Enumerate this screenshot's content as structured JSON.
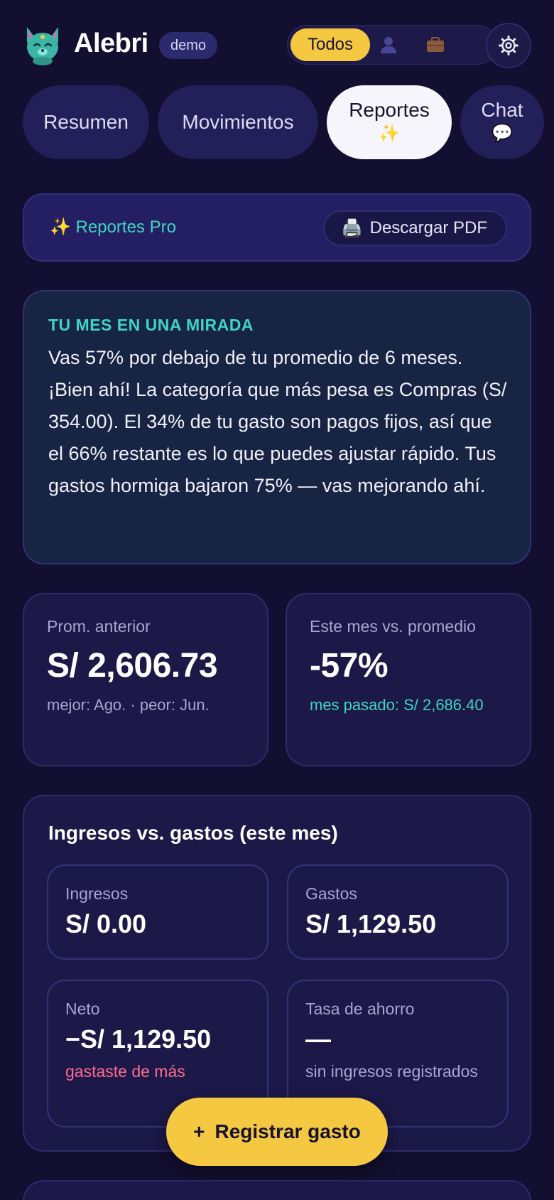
{
  "header": {
    "app_name": "Alebri",
    "mode_badge": "demo",
    "filter": {
      "todos_label": "Todos",
      "personal_icon": "person-icon",
      "business_icon": "briefcase-icon"
    },
    "settings_icon": "gear-icon"
  },
  "tabs": [
    {
      "label": "Resumen"
    },
    {
      "label": "Movimientos"
    },
    {
      "label": "Reportes",
      "emoji": "✨"
    },
    {
      "label": "Chat",
      "emoji": "💬"
    }
  ],
  "pro_bar": {
    "label": "✨ Reportes Pro",
    "download_icon": "🖨️",
    "download_label": "Descargar PDF"
  },
  "insight": {
    "title": "TU MES EN UNA MIRADA",
    "body": "Vas 57% por debajo de tu promedio de 6 meses. ¡Bien ahí! La categoría que más pesa es Compras (S/ 354.00). El 34% de tu gasto son pagos fijos, así que el 66% restante es lo que puedes ajustar rápido. Tus gastos hormiga bajaron 75% — vas mejorando ahí."
  },
  "stats": {
    "avg": {
      "label": "Prom. anterior",
      "value": "S/ 2,606.73",
      "sub": "mejor: Ago. · peor: Jun."
    },
    "vs": {
      "label": "Este mes vs. promedio",
      "value": "-57%",
      "sub": "mes pasado: S/ 2,686.40"
    }
  },
  "income_vs_expenses": {
    "title": "Ingresos vs. gastos (este mes)",
    "income": {
      "label": "Ingresos",
      "value": "S/ 0.00"
    },
    "expenses": {
      "label": "Gastos",
      "value": "S/ 1,129.50"
    },
    "net": {
      "label": "Neto",
      "value": "−S/ 1,129.50",
      "sub": "gastaste de más"
    },
    "savings": {
      "label": "Tasa de ahorro",
      "value": "—",
      "sub": "sin ingresos registrados"
    }
  },
  "fab": {
    "plus": "+",
    "label": "Registrar gasto"
  },
  "colors": {
    "background": "#130f30",
    "accent_yellow": "#f5c842",
    "accent_teal": "#3fd5c2",
    "negative": "#ff6b8e"
  }
}
